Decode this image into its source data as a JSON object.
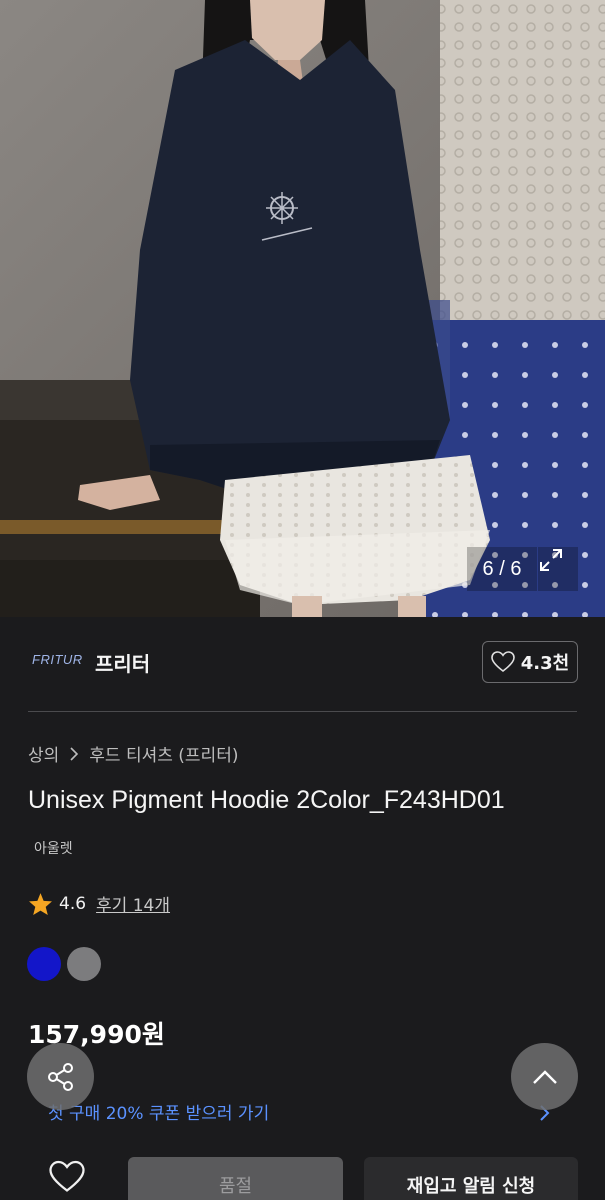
{
  "gallery": {
    "pager": "6 / 6"
  },
  "brand": {
    "logo_text": "FRITUR",
    "name": "프리터",
    "likes": "4.3천"
  },
  "breadcrumb": {
    "category": "상의",
    "subcategory": "후드 티셔츠 (프리터)"
  },
  "product": {
    "title": "Unisex Pigment Hoodie 2Color_F243HD01",
    "tag": "아울렛",
    "rating": "4.6",
    "reviews": "후기 14개",
    "price": "157,990원",
    "colors": [
      "#1316c9",
      "#7c7c7e"
    ]
  },
  "coupon": {
    "text": "첫 구매 20% 쿠폰 받으러 가기"
  },
  "actions": {
    "sold_out": "품절",
    "restock": "재입고 알림 신청"
  },
  "icons": {
    "expand": "expand-icon",
    "heart": "heart-icon",
    "chevron_right": "chevron-right-icon",
    "star": "star-icon",
    "share": "share-icon",
    "scroll_top": "chevron-up-icon"
  },
  "colors": {
    "background": "#1b1b1d",
    "accent_link": "#5b92ff",
    "star": "#f5a623"
  }
}
